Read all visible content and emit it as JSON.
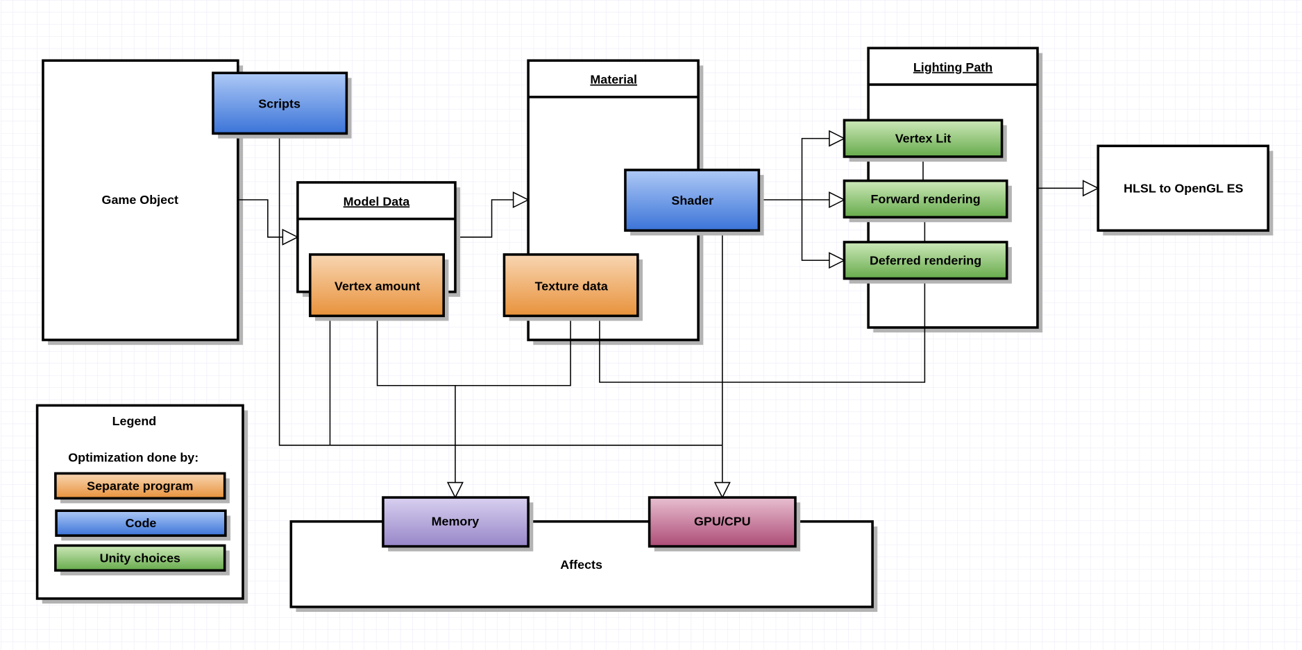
{
  "nodes": {
    "game_object": "Game Object",
    "scripts": "Scripts",
    "model_data": "Model Data",
    "vertex_amount": "Vertex amount",
    "material": "Material",
    "texture_data": "Texture data",
    "shader": "Shader",
    "lighting_path": "Lighting Path",
    "vertex_lit": "Vertex Lit",
    "forward_rendering": "Forward rendering",
    "deferred_rendering": "Deferred rendering",
    "hlsl": "HLSL to OpenGL ES",
    "affects": "Affects",
    "memory": "Memory",
    "gpu_cpu": "GPU/CPU"
  },
  "legend": {
    "title": "Legend",
    "subtitle": "Optimization done by:",
    "items": [
      {
        "label": "Separate program",
        "color": "orange"
      },
      {
        "label": "Code",
        "color": "blue"
      },
      {
        "label": "Unity choices",
        "color": "green"
      }
    ]
  },
  "colors": {
    "orange_top": "#f8d6b2",
    "orange_bottom": "#e8923b",
    "blue_top": "#aec9f6",
    "blue_bottom": "#3b74d8",
    "green_top": "#cde8b9",
    "green_bottom": "#66ab4b",
    "purple_top": "#d8d0f0",
    "purple_bottom": "#9786c8",
    "pink_top": "#e8bfd0",
    "pink_bottom": "#ad4c77",
    "grid": "#e6e6f6"
  }
}
